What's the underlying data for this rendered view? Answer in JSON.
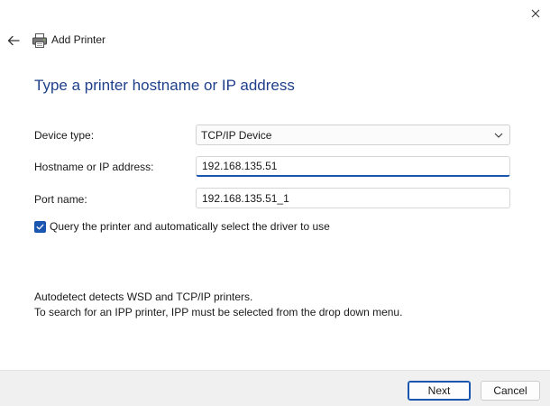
{
  "header": {
    "title": "Add Printer",
    "back_icon": "back-arrow-icon",
    "app_icon": "printer-icon",
    "close_icon": "close-icon"
  },
  "page": {
    "heading": "Type a printer hostname or IP address"
  },
  "form": {
    "device_type_label": "Device type:",
    "device_type_value": "TCP/IP Device",
    "hostname_label": "Hostname or IP address:",
    "hostname_value": "192.168.135.51",
    "port_label": "Port name:",
    "port_value": "192.168.135.51_1",
    "query_checkbox_label": "Query the printer and automatically select the driver to use",
    "query_checkbox_checked": true
  },
  "info": {
    "line1": "Autodetect detects WSD and TCP/IP printers.",
    "line2": "To search for an IPP printer, IPP must be selected from the drop down menu."
  },
  "footer": {
    "next_label": "Next",
    "cancel_label": "Cancel"
  },
  "colors": {
    "accent": "#1a56b0",
    "heading": "#1f3f8a",
    "footer_bg": "#f0f0f0"
  }
}
